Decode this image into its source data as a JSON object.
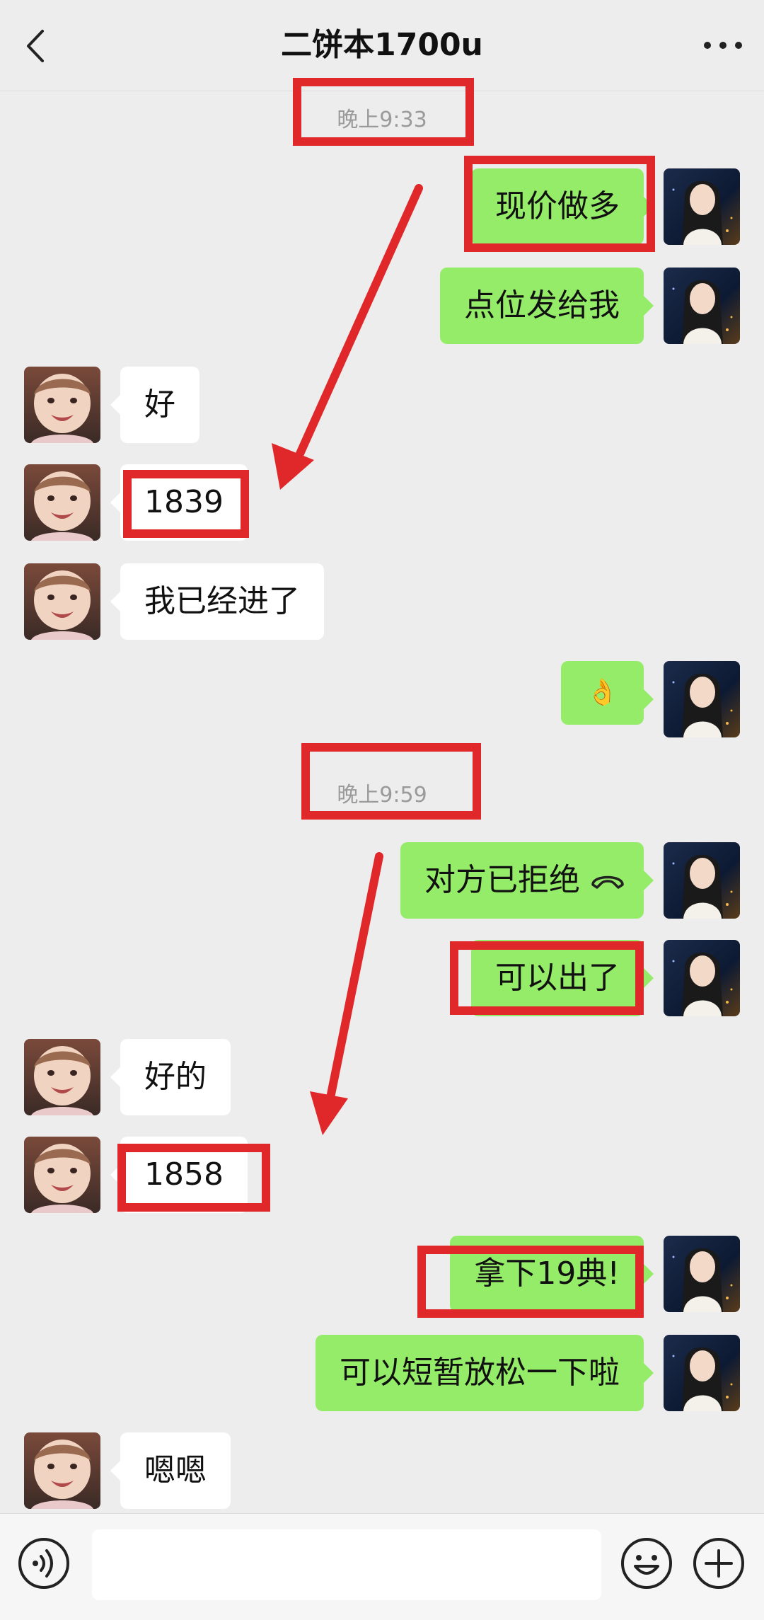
{
  "header": {
    "title": "二饼本1700u"
  },
  "timestamps": [
    "晚上9:33",
    "晚上9:59"
  ],
  "messages": [
    {
      "from": "me",
      "text": "现价做多"
    },
    {
      "from": "me",
      "text": "点位发给我"
    },
    {
      "from": "them",
      "text": "好"
    },
    {
      "from": "them",
      "text": "1839"
    },
    {
      "from": "them",
      "text": "我已经进了"
    },
    {
      "from": "me",
      "text": "👌"
    },
    {
      "from": "me",
      "text": "对方已拒绝"
    },
    {
      "from": "me",
      "text": "可以出了"
    },
    {
      "from": "them",
      "text": "好的"
    },
    {
      "from": "them",
      "text": "1858"
    },
    {
      "from": "me",
      "text": "拿下19典!"
    },
    {
      "from": "me",
      "text": "可以短暂放松一下啦"
    },
    {
      "from": "them",
      "text": "嗯嗯"
    }
  ],
  "colors": {
    "my_bubble": "#95ec69",
    "their_bubble": "#ffffff",
    "annotation": "#e0282a",
    "background": "#ededed"
  },
  "icons": [
    "back-icon",
    "more-icon",
    "voice-icon",
    "emoji-icon",
    "plus-icon",
    "phone-hangup-icon"
  ]
}
